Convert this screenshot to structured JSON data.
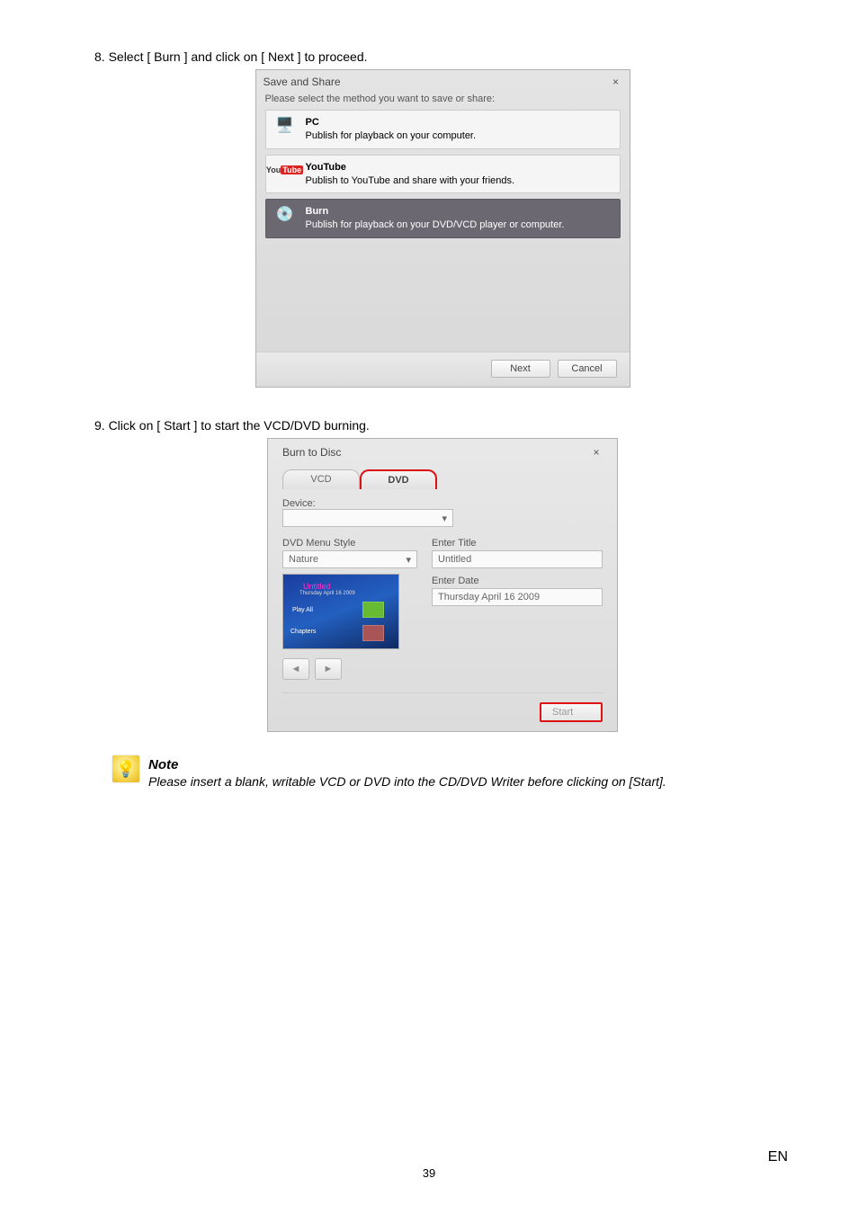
{
  "step8": "8. Select [ Burn ] and click on [ Next ] to proceed.",
  "dialog1": {
    "title": "Save and Share",
    "close": "×",
    "instruction": "Please select the method you want to save or share:",
    "options": [
      {
        "title": "PC",
        "desc": "Publish for playback on your computer."
      },
      {
        "title": "YouTube",
        "desc": "Publish to YouTube and share with your friends."
      },
      {
        "title": "Burn",
        "desc": "Publish for playback on your DVD/VCD player or computer."
      }
    ],
    "next": "Next",
    "cancel": "Cancel"
  },
  "step9": "9. Click on [ Start ] to start the VCD/DVD burning.",
  "dialog2": {
    "title": "Burn to Disc",
    "close": "×",
    "tabs": {
      "vcd": "VCD",
      "dvd": "DVD"
    },
    "device_label": "Device:",
    "menu_style_label": "DVD Menu Style",
    "menu_style_value": "Nature",
    "title_label": "Enter Title",
    "title_value": "Untitled",
    "date_label": "Enter Date",
    "date_value": "Thursday  April 16  2009",
    "preview": {
      "title": "Untitled",
      "sub": "Thursday April 16 2009",
      "play": "Play All",
      "chapters": "Chapters"
    },
    "start": "Start"
  },
  "note": {
    "label": "Note",
    "text": "Please insert a blank, writable VCD or DVD into the CD/DVD Writer before clicking on [Start]."
  },
  "footer": {
    "page": "39",
    "lang": "EN"
  }
}
